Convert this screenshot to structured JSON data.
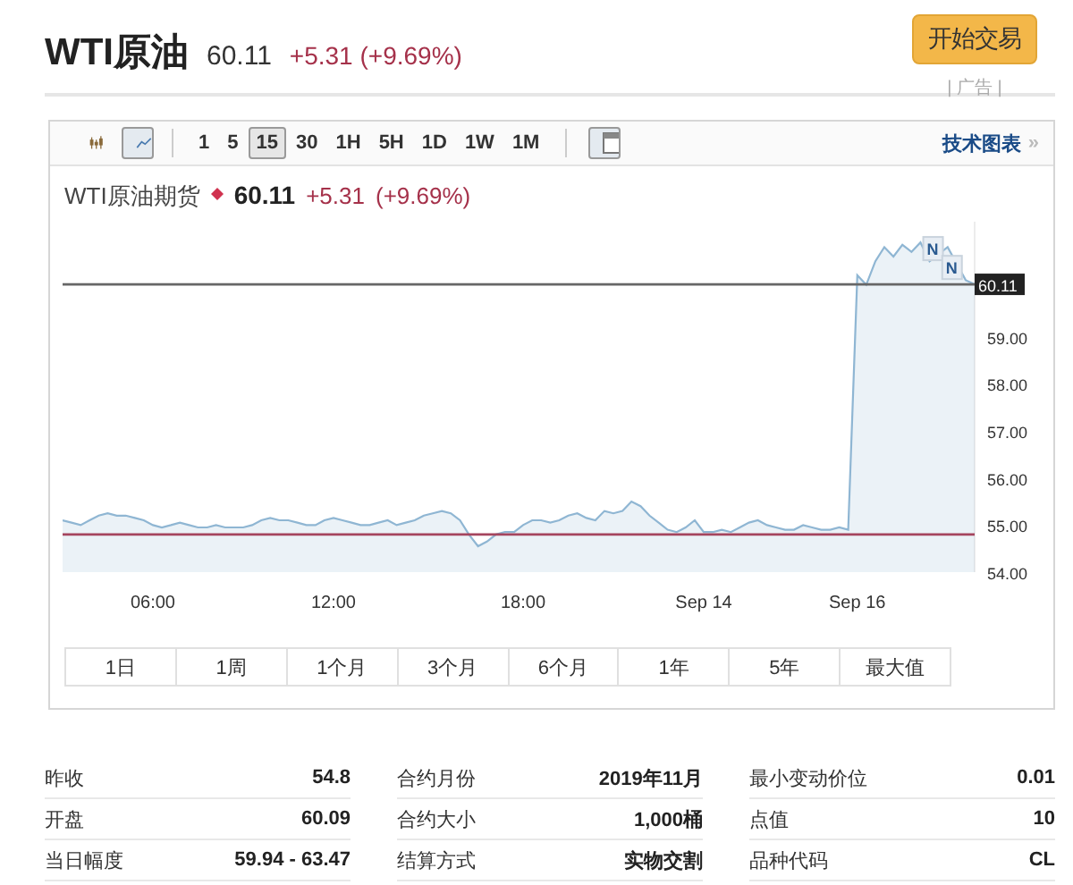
{
  "header": {
    "title": "WTI原油",
    "price": "60.11",
    "change": "+5.31 (+9.69%)",
    "button": "开始交易",
    "ad_label": "| 广告 |"
  },
  "chart_panel": {
    "toolbar": {
      "chart_types": [
        {
          "kind": "candles",
          "selected": false
        },
        {
          "kind": "line",
          "selected": true
        }
      ],
      "intervals": [
        {
          "label": "1",
          "selected": false
        },
        {
          "label": "5",
          "selected": false
        },
        {
          "label": "15",
          "selected": true
        },
        {
          "label": "30",
          "selected": false
        },
        {
          "label": "1H",
          "selected": false
        },
        {
          "label": "5H",
          "selected": false
        },
        {
          "label": "1D",
          "selected": false
        },
        {
          "label": "1W",
          "selected": false
        },
        {
          "label": "1M",
          "selected": false
        }
      ],
      "link": "技术图表",
      "link_arrow": "»"
    },
    "price": "60.11",
    "change": "+5.31",
    "change_percent": "(+9.69%)",
    "event_flags": [
      {
        "label": "N"
      },
      {
        "label": "N"
      }
    ],
    "chart_data": {
      "type": "area",
      "title": "WTI原油期货",
      "categories": [
        null,
        null,
        null,
        null,
        null,
        null,
        null,
        null,
        null,
        null,
        "06:00",
        null,
        null,
        null,
        null,
        null,
        null,
        null,
        null,
        null,
        null,
        null,
        null,
        null,
        null,
        null,
        null,
        null,
        null,
        null,
        "12:00",
        null,
        null,
        null,
        null,
        null,
        null,
        null,
        null,
        null,
        null,
        null,
        null,
        null,
        null,
        null,
        null,
        null,
        null,
        null,
        null,
        "18:00",
        null,
        null,
        null,
        null,
        null,
        null,
        null,
        null,
        null,
        null,
        null,
        null,
        null,
        null,
        null,
        null,
        null,
        null,
        null,
        "Sep 14",
        null,
        null,
        null,
        null,
        null,
        null,
        null,
        null,
        null,
        null,
        null,
        null,
        null,
        null,
        null,
        null,
        "Sep 16",
        null,
        null,
        null,
        null,
        null,
        null,
        null,
        null,
        null,
        null,
        null,
        null,
        null
      ],
      "ylim": [
        54,
        61.44
      ],
      "yticks": [
        {
          "value": 54,
          "label": "54.00"
        },
        {
          "value": 55,
          "label": "55.00"
        },
        {
          "value": 56,
          "label": "56.00"
        },
        {
          "value": 57,
          "label": "57.00"
        },
        {
          "value": 58,
          "label": "58.00"
        },
        {
          "value": 59,
          "label": "59.00"
        }
      ],
      "series": [
        {
          "color": "#8fb6d3",
          "values": [
            55.1,
            55.05,
            55.0,
            55.1,
            55.2,
            55.25,
            55.2,
            55.2,
            55.15,
            55.1,
            55.0,
            54.95,
            55.0,
            55.05,
            55.0,
            54.95,
            54.95,
            55.0,
            54.95,
            54.95,
            54.95,
            55.0,
            55.1,
            55.15,
            55.1,
            55.1,
            55.05,
            55.0,
            55.0,
            55.1,
            55.15,
            55.1,
            55.05,
            55.0,
            55.0,
            55.05,
            55.1,
            55.0,
            55.05,
            55.1,
            55.2,
            55.25,
            55.3,
            55.25,
            55.1,
            54.8,
            54.55,
            54.65,
            54.8,
            54.85,
            54.85,
            55.0,
            55.1,
            55.1,
            55.05,
            55.1,
            55.2,
            55.25,
            55.15,
            55.1,
            55.3,
            55.25,
            55.3,
            55.5,
            55.4,
            55.2,
            55.05,
            54.9,
            54.85,
            54.95,
            55.1,
            54.85,
            54.85,
            54.9,
            54.85,
            54.95,
            55.05,
            55.1,
            55.0,
            54.95,
            54.9,
            54.9,
            55.0,
            54.95,
            54.9,
            54.9,
            54.95,
            54.9,
            60.3,
            60.1,
            60.6,
            60.9,
            60.7,
            60.95,
            60.8,
            61.0,
            60.6,
            null,
            60.9,
            null,
            60.2,
            60.11
          ]
        }
      ],
      "ref_lines": [
        {
          "axis": "y",
          "value": 54.8,
          "color": "#a5455e"
        },
        {
          "axis": "y",
          "value": 60.11,
          "color": "#666666",
          "label": "60.11"
        }
      ]
    },
    "ranges": [
      {
        "label": "1日",
        "selected": false
      },
      {
        "label": "1周",
        "selected": false
      },
      {
        "label": "1个月",
        "selected": false
      },
      {
        "label": "3个月",
        "selected": false
      },
      {
        "label": "6个月",
        "selected": false
      },
      {
        "label": "1年",
        "selected": false
      },
      {
        "label": "5年",
        "selected": false
      },
      {
        "label": "最大值",
        "selected": false
      }
    ]
  },
  "stats": {
    "columns": [
      [
        {
          "label": "昨收",
          "value": "54.8"
        },
        {
          "label": "开盘",
          "value": "60.09"
        },
        {
          "label": "当日幅度",
          "value": "59.94 - 63.47"
        }
      ],
      [
        {
          "label": "合约月份",
          "value": "2019年11月"
        },
        {
          "label": "合约大小",
          "value": "1,000桶"
        },
        {
          "label": "结算方式",
          "value": "实物交割"
        }
      ],
      [
        {
          "label": "最小变动价位",
          "value": "0.01"
        },
        {
          "label": "点值",
          "value": "10"
        },
        {
          "label": "品种代码",
          "value": "CL"
        }
      ]
    ]
  }
}
